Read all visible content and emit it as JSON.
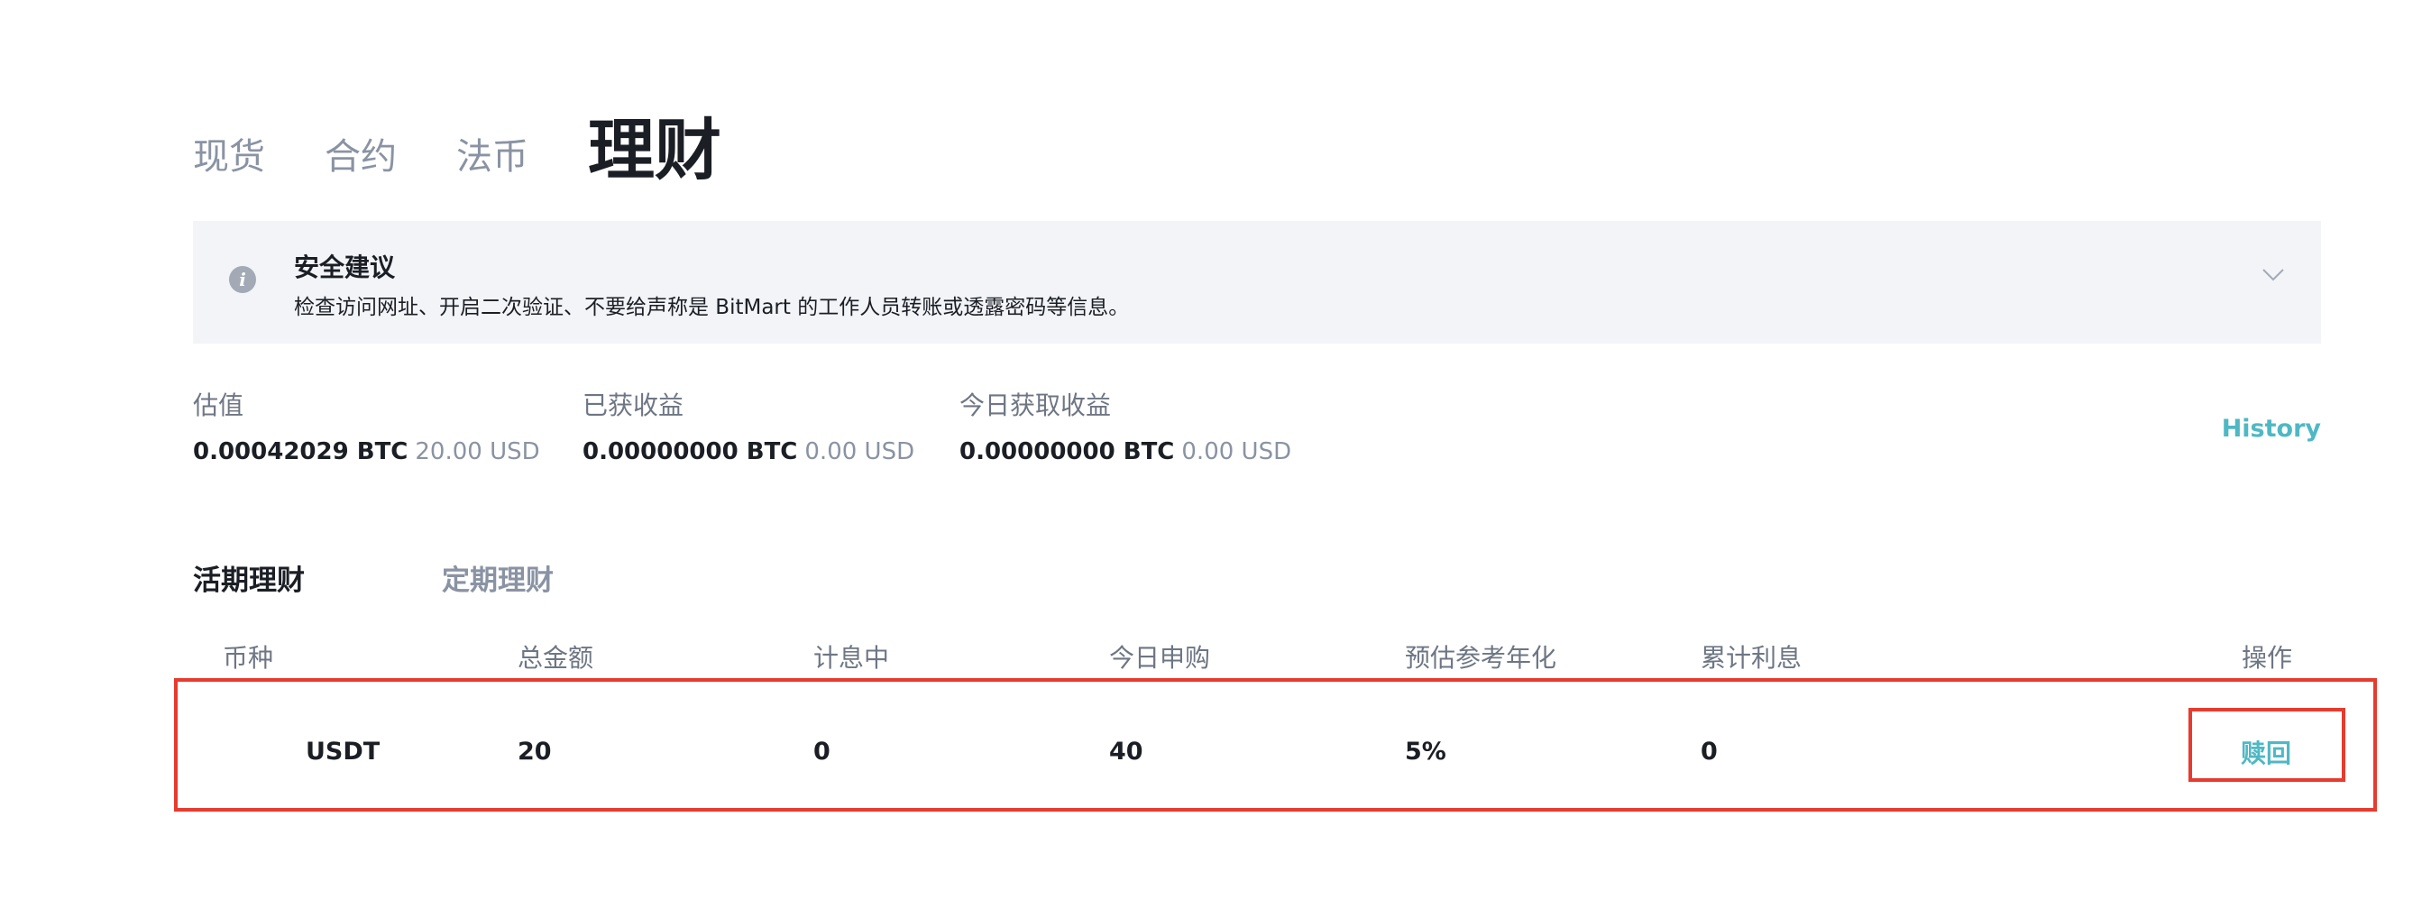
{
  "tabs": [
    {
      "label": "现货",
      "active": false
    },
    {
      "label": "合约",
      "active": false
    },
    {
      "label": "法币",
      "active": false
    },
    {
      "label": "理财",
      "active": true
    }
  ],
  "notice": {
    "icon": "info-icon",
    "title": "安全建议",
    "text": "检查访问网址、开启二次验证、不要给声称是 BitMart 的工作人员转账或透露密码等信息。"
  },
  "stats": [
    {
      "label": "估值",
      "btc": "0.00042029 BTC",
      "usd": "20.00 USD"
    },
    {
      "label": "已获收益",
      "btc": "0.00000000 BTC",
      "usd": "0.00 USD"
    },
    {
      "label": "今日获取收益",
      "btc": "0.00000000 BTC",
      "usd": "0.00 USD"
    }
  ],
  "history_label": "History",
  "subtabs": [
    {
      "label": "活期理财",
      "active": true
    },
    {
      "label": "定期理财",
      "active": false
    }
  ],
  "table": {
    "headers": [
      "币种",
      "总金额",
      "计息中",
      "今日申购",
      "预估参考年化",
      "累计利息",
      "操作"
    ],
    "rows": [
      {
        "coin": "USDT",
        "total": "20",
        "accruing": "0",
        "today_purchase": "40",
        "apy": "5%",
        "interest": "0",
        "action": "赎回"
      }
    ]
  },
  "colors": {
    "accent": "#4fb8c4",
    "highlight": "#e63b2e",
    "notice_bg": "#f2f4f8"
  }
}
